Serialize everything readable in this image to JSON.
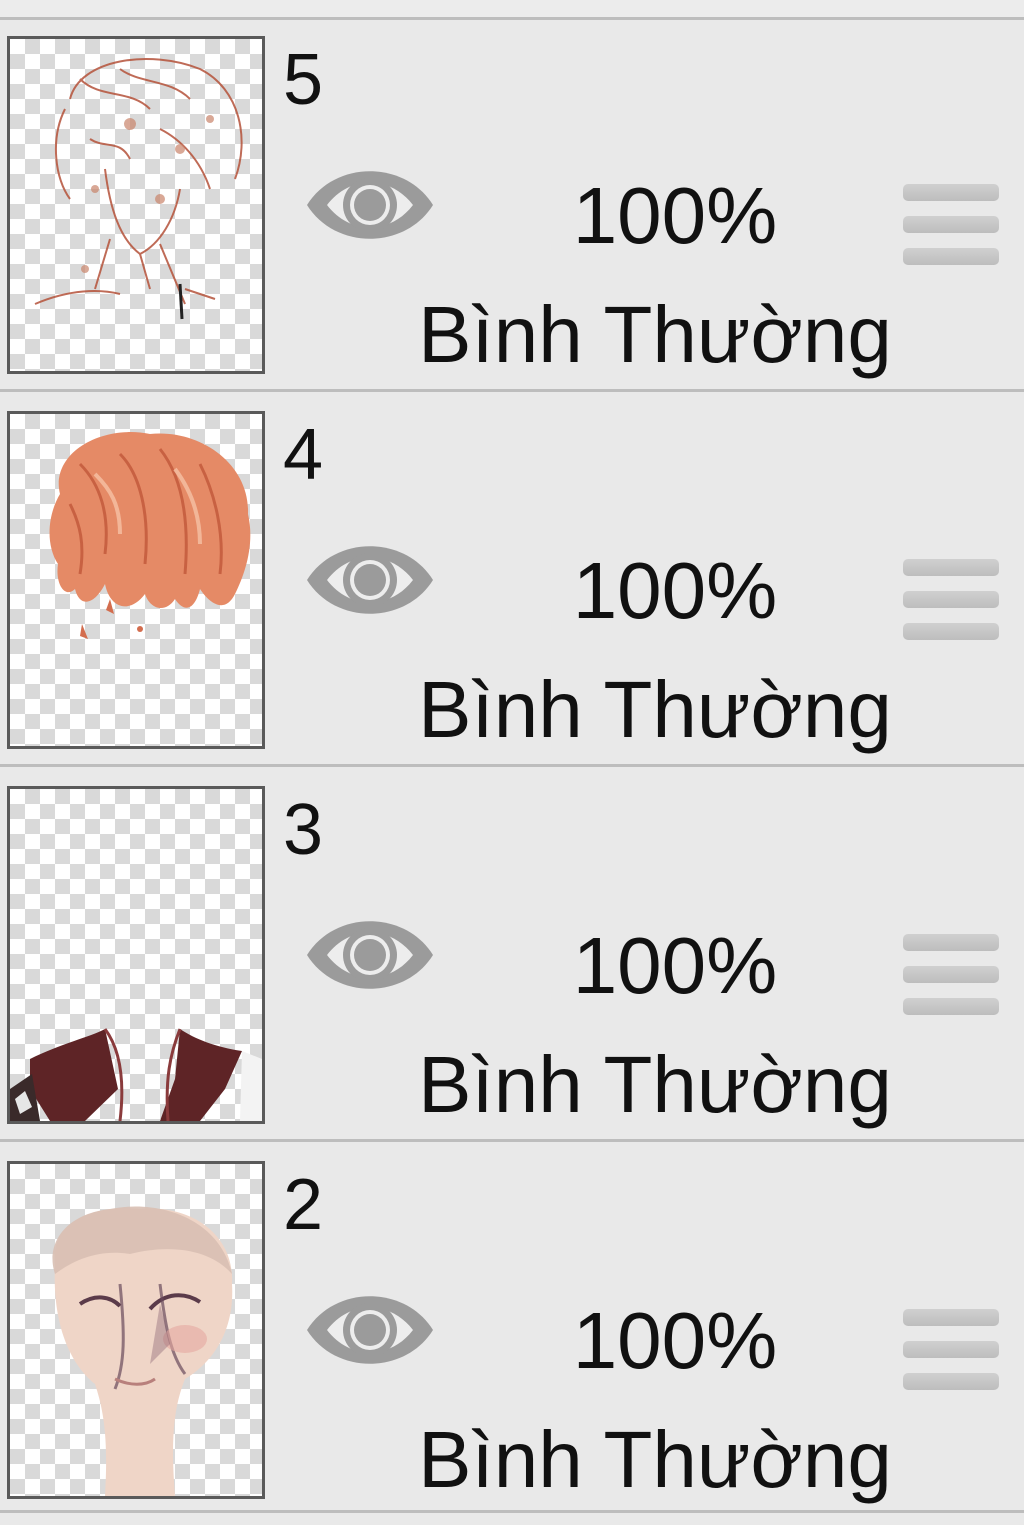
{
  "layers_panel": {
    "layers": [
      {
        "number": "5",
        "opacity": "100%",
        "blend_mode": "Bình Thường",
        "visibility_icon": "eye-icon",
        "handle_icon": "drag-handle-icon",
        "thumbnail_content": "sketch"
      },
      {
        "number": "4",
        "opacity": "100%",
        "blend_mode": "Bình Thường",
        "visibility_icon": "eye-icon",
        "handle_icon": "drag-handle-icon",
        "thumbnail_content": "hair"
      },
      {
        "number": "3",
        "opacity": "100%",
        "blend_mode": "Bình Thường",
        "visibility_icon": "eye-icon",
        "handle_icon": "drag-handle-icon",
        "thumbnail_content": "collar"
      },
      {
        "number": "2",
        "opacity": "100%",
        "blend_mode": "Bình Thường",
        "visibility_icon": "eye-icon",
        "handle_icon": "drag-handle-icon",
        "thumbnail_content": "face"
      }
    ]
  },
  "colors": {
    "panel_background": "#e9e9e9",
    "divider": "#bdbdbd",
    "eye_icon": "#9b9b9b",
    "text": "#111111"
  }
}
